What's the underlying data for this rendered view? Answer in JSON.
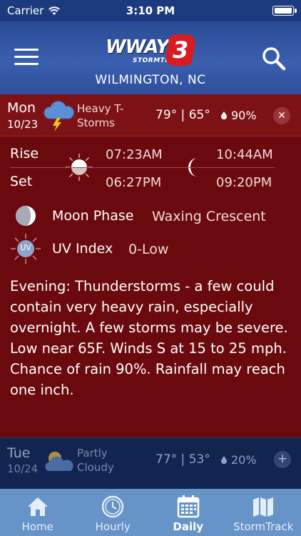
{
  "status_bar": {
    "carrier": "Carrier",
    "time": "3:10 PM"
  },
  "header": {
    "logo_text": "WWAY",
    "logo_sub": "STORMTRACK",
    "logo_badge": "3",
    "location": "WILMINGTON, NC"
  },
  "selected_day": {
    "day": "Mon",
    "date": "10/23",
    "condition_line1": "Heavy T-",
    "condition_line2": "Storms",
    "high": "79°",
    "separator": "|",
    "low": "65°",
    "precip": "90%",
    "icon": "thunderstorm-icon",
    "close_glyph": "✕",
    "rise_label": "Rise",
    "set_label": "Set",
    "sunrise": "07:23AM",
    "sunset": "06:27PM",
    "moonrise": "10:44AM",
    "moonset": "09:20PM",
    "moon_phase_label": "Moon Phase",
    "moon_phase": "Waxing Crescent",
    "uv_label": "UV Index",
    "uv_icon_text": "UV",
    "uv_value": "0-Low",
    "description": "Evening: Thunderstorms - a few could contain very heavy rain, especially overnight. A few storms may be severe. Low near 65F. Winds S at 15 to 25 mph. Chance of rain 90%. Rainfall may reach one inch."
  },
  "next_day": {
    "day": "Tue",
    "date": "10/24",
    "condition_line1": "Partly",
    "condition_line2": "Cloudy",
    "high": "77°",
    "separator": "|",
    "low": "53°",
    "precip": "20%",
    "icon": "partly-cloudy-icon",
    "expand_glyph": "+"
  },
  "tabs": [
    {
      "label": "Home",
      "icon": "home-icon"
    },
    {
      "label": "Hourly",
      "icon": "clock-icon"
    },
    {
      "label": "Daily",
      "icon": "calendar-icon",
      "active": true
    },
    {
      "label": "StormTrack",
      "icon": "map-icon"
    }
  ],
  "colors": {
    "header": "#3a5fae",
    "panel": "#6b0a0e",
    "tabbar": "#6693c8"
  }
}
